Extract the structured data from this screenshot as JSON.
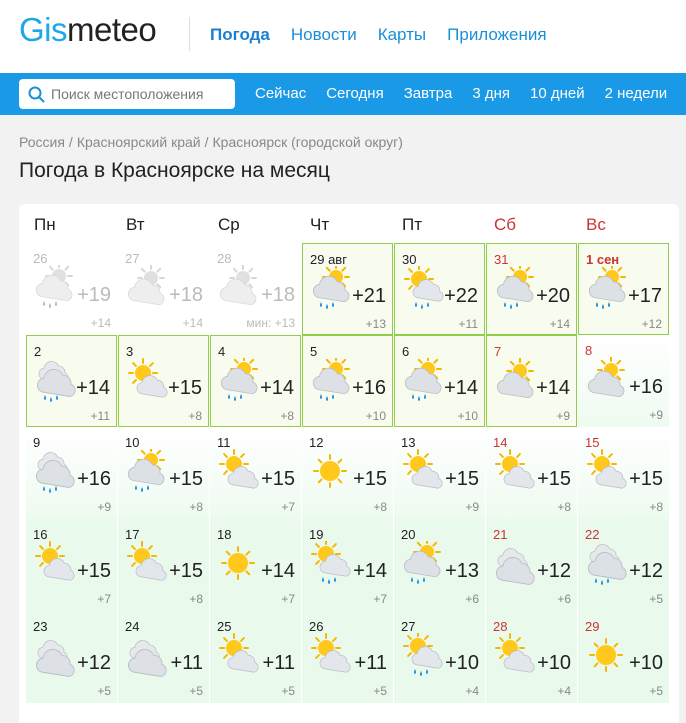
{
  "header": {
    "logo_part1": "Gis",
    "logo_part2": "meteo",
    "nav": [
      {
        "label": "Погода",
        "active": true
      },
      {
        "label": "Новости",
        "active": false
      },
      {
        "label": "Карты",
        "active": false
      },
      {
        "label": "Приложения",
        "active": false
      }
    ]
  },
  "search": {
    "placeholder": "Поиск местоположения",
    "icon": "search-icon"
  },
  "subnav": [
    "Сейчас",
    "Сегодня",
    "Завтра",
    "3 дня",
    "10 дней",
    "2 недели"
  ],
  "breadcrumb": [
    "Россия",
    "Красноярский край",
    "Красноярск (городской округ)"
  ],
  "page_title": "Погода в Красноярске на месяц",
  "colors": {
    "brand": "#1ca7e8",
    "bar": "#1a99e6",
    "weekend": "#cc3333",
    "highlight_border": "#8fcd4a"
  },
  "weekdays": [
    {
      "label": "Пн",
      "weekend": false
    },
    {
      "label": "Вт",
      "weekend": false
    },
    {
      "label": "Ср",
      "weekend": false
    },
    {
      "label": "Чт",
      "weekend": false
    },
    {
      "label": "Пт",
      "weekend": false
    },
    {
      "label": "Сб",
      "weekend": true
    },
    {
      "label": "Вс",
      "weekend": true
    }
  ],
  "weeks": [
    [
      {
        "date": "26",
        "hi": "+19",
        "lo": "+14",
        "icon": "cloud-sun-rain-icon",
        "state": "past"
      },
      {
        "date": "27",
        "hi": "+18",
        "lo": "+14",
        "icon": "cloud-sun-icon",
        "state": "past"
      },
      {
        "date": "28",
        "hi": "+18",
        "lo": "мин: +13",
        "icon": "cloud-sun-icon",
        "state": "past"
      },
      {
        "date": "29 авг",
        "hi": "+21",
        "lo": "+13",
        "icon": "cloud-sun-rain-icon",
        "state": "hl"
      },
      {
        "date": "30",
        "hi": "+22",
        "lo": "+11",
        "icon": "sun-cloud-rain-icon",
        "state": "hl"
      },
      {
        "date": "31",
        "hi": "+20",
        "lo": "+14",
        "icon": "cloud-sun-rain-icon",
        "state": "hl",
        "weekend": true
      },
      {
        "date": "1 сен",
        "hi": "+17",
        "lo": "+12",
        "icon": "cloud-sun-rain-icon",
        "state": "hl",
        "weekend": true,
        "first": true
      }
    ],
    [
      {
        "date": "2",
        "hi": "+14",
        "lo": "+11",
        "icon": "cloud-rain-icon",
        "state": "hl"
      },
      {
        "date": "3",
        "hi": "+15",
        "lo": "+8",
        "icon": "sun-cloud-icon",
        "state": "hl"
      },
      {
        "date": "4",
        "hi": "+14",
        "lo": "+8",
        "icon": "cloud-sun-rain-icon",
        "state": "hl"
      },
      {
        "date": "5",
        "hi": "+16",
        "lo": "+10",
        "icon": "cloud-sun-rain-icon",
        "state": "hl"
      },
      {
        "date": "6",
        "hi": "+14",
        "lo": "+10",
        "icon": "cloud-sun-rain-icon",
        "state": "hl"
      },
      {
        "date": "7",
        "hi": "+14",
        "lo": "+9",
        "icon": "cloud-sun-icon",
        "state": "hl",
        "weekend": true
      },
      {
        "date": "8",
        "hi": "+16",
        "lo": "+9",
        "icon": "cloud-sun-icon",
        "state": "fade",
        "weekend": true
      }
    ],
    [
      {
        "date": "9",
        "hi": "+16",
        "lo": "+9",
        "icon": "cloud-rain-icon",
        "state": "fade"
      },
      {
        "date": "10",
        "hi": "+15",
        "lo": "+8",
        "icon": "cloud-sun-rain-icon",
        "state": "fade"
      },
      {
        "date": "11",
        "hi": "+15",
        "lo": "+7",
        "icon": "sun-cloud-icon",
        "state": "fade"
      },
      {
        "date": "12",
        "hi": "+15",
        "lo": "+8",
        "icon": "sun-icon",
        "state": "fade"
      },
      {
        "date": "13",
        "hi": "+15",
        "lo": "+9",
        "icon": "sun-cloud-icon",
        "state": "fade"
      },
      {
        "date": "14",
        "hi": "+15",
        "lo": "+8",
        "icon": "sun-cloud-icon",
        "state": "fade",
        "weekend": true
      },
      {
        "date": "15",
        "hi": "+15",
        "lo": "+8",
        "icon": "sun-cloud-icon",
        "state": "fade",
        "weekend": true
      }
    ],
    [
      {
        "date": "16",
        "hi": "+15",
        "lo": "+7",
        "icon": "sun-cloud-icon",
        "state": "future"
      },
      {
        "date": "17",
        "hi": "+15",
        "lo": "+8",
        "icon": "sun-cloud-icon",
        "state": "future"
      },
      {
        "date": "18",
        "hi": "+14",
        "lo": "+7",
        "icon": "sun-icon",
        "state": "future"
      },
      {
        "date": "19",
        "hi": "+14",
        "lo": "+7",
        "icon": "sun-cloud-rain-icon",
        "state": "future"
      },
      {
        "date": "20",
        "hi": "+13",
        "lo": "+6",
        "icon": "cloud-sun-rain-icon",
        "state": "future"
      },
      {
        "date": "21",
        "hi": "+12",
        "lo": "+6",
        "icon": "cloud-icon",
        "state": "future",
        "weekend": true
      },
      {
        "date": "22",
        "hi": "+12",
        "lo": "+5",
        "icon": "cloud-rain-icon",
        "state": "future",
        "weekend": true
      }
    ],
    [
      {
        "date": "23",
        "hi": "+12",
        "lo": "+5",
        "icon": "cloud-icon",
        "state": "future"
      },
      {
        "date": "24",
        "hi": "+11",
        "lo": "+5",
        "icon": "cloud-icon",
        "state": "future"
      },
      {
        "date": "25",
        "hi": "+11",
        "lo": "+5",
        "icon": "sun-cloud-icon",
        "state": "future"
      },
      {
        "date": "26",
        "hi": "+11",
        "lo": "+5",
        "icon": "sun-cloud-icon",
        "state": "future"
      },
      {
        "date": "27",
        "hi": "+10",
        "lo": "+4",
        "icon": "sun-cloud-rain-icon",
        "state": "future"
      },
      {
        "date": "28",
        "hi": "+10",
        "lo": "+4",
        "icon": "sun-cloud-icon",
        "state": "future",
        "weekend": true
      },
      {
        "date": "29",
        "hi": "+10",
        "lo": "+5",
        "icon": "sun-icon",
        "state": "future",
        "weekend": true
      }
    ]
  ]
}
